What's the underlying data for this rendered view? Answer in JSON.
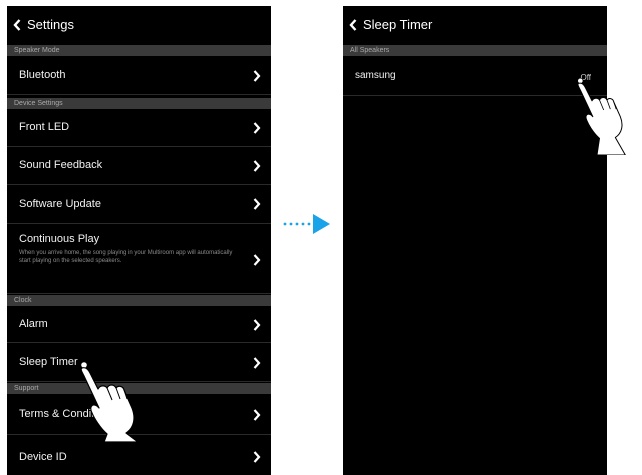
{
  "left_screen": {
    "header": {
      "title": "Settings",
      "back_icon": "chevron-left-icon"
    },
    "sections": [
      {
        "title": "Speaker Mode",
        "rows": [
          {
            "label": "Bluetooth"
          }
        ]
      },
      {
        "title": "Device Settings",
        "rows": [
          {
            "label": "Front LED"
          },
          {
            "label": "Sound Feedback"
          },
          {
            "label": "Software Update"
          },
          {
            "label": "Continuous Play",
            "description": "When you arrive home, the song playing in your Multiroom app will automatically start playing on the selected speakers."
          }
        ]
      },
      {
        "title": "Clock",
        "rows": [
          {
            "label": "Alarm"
          },
          {
            "label": "Sleep Timer"
          }
        ]
      },
      {
        "title": "Support",
        "rows": [
          {
            "label": "Terms & Conditions"
          },
          {
            "label": "Device ID"
          }
        ]
      }
    ]
  },
  "right_screen": {
    "header": {
      "title": "Sleep Timer",
      "back_icon": "chevron-left-icon"
    },
    "sections": [
      {
        "title": "All Speakers",
        "rows": [
          {
            "label": "samsung",
            "value": "Off"
          }
        ]
      }
    ]
  },
  "transition_icon": "dotted-arrow-right-icon",
  "pointer_icon": "hand-pointer-icon",
  "colors": {
    "screen_bg": "#000000",
    "section_bg": "#3a3a3a",
    "arrow": "#1aa3e8"
  }
}
